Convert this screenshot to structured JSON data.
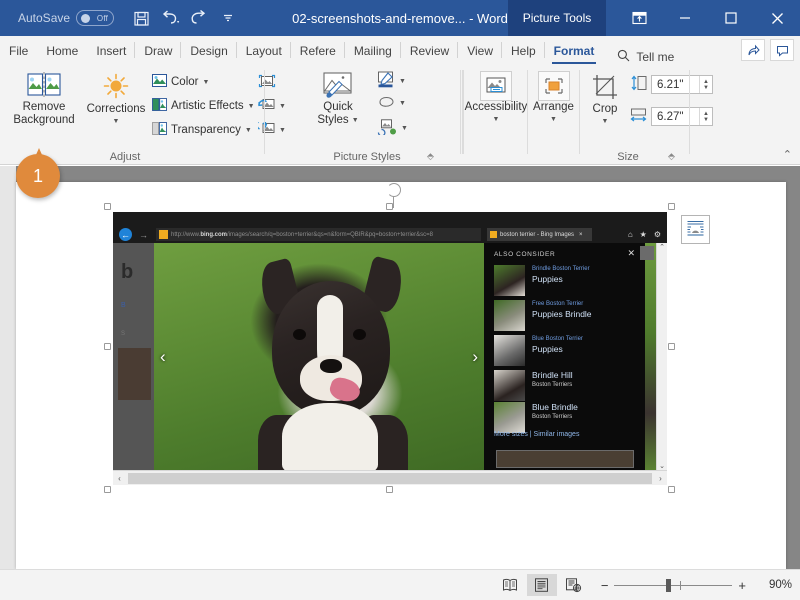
{
  "titlebar": {
    "autosave_label": "AutoSave",
    "autosave_state": "Off",
    "quick_access": [
      {
        "name": "save-icon",
        "label": "Save"
      },
      {
        "name": "undo-icon",
        "label": "Undo"
      },
      {
        "name": "redo-icon",
        "label": "Redo"
      },
      {
        "name": "customize-qat-icon",
        "label": "Customize Quick Access Toolbar"
      }
    ],
    "document_title": "02-screenshots-and-remove... - Word",
    "contextual_tab": "Picture Tools",
    "window_buttons": [
      {
        "name": "ribbon-display-options-icon",
        "label": "Ribbon Display Options"
      },
      {
        "name": "minimize-icon",
        "label": "Minimize"
      },
      {
        "name": "maximize-icon",
        "label": "Maximize"
      },
      {
        "name": "close-icon",
        "label": "Close"
      }
    ],
    "bg_color": "#2b579a",
    "contextual_bg_color": "#1e417d"
  },
  "tabs": [
    {
      "label": "File",
      "active": false
    },
    {
      "label": "Home",
      "active": false
    },
    {
      "label": "Insert",
      "active": false
    },
    {
      "label": "Draw",
      "active": false
    },
    {
      "label": "Design",
      "active": false
    },
    {
      "label": "Layout",
      "active": false
    },
    {
      "label": "Refere",
      "active": false
    },
    {
      "label": "Mailing",
      "active": false
    },
    {
      "label": "Review",
      "active": false
    },
    {
      "label": "View",
      "active": false
    },
    {
      "label": "Help",
      "active": false
    },
    {
      "label": "Format",
      "active": true
    }
  ],
  "tellme": {
    "label": "Tell me",
    "icon": "search-icon"
  },
  "tab_right_buttons": [
    {
      "name": "share-icon",
      "label": "Share"
    },
    {
      "name": "comments-icon",
      "label": "Comments"
    }
  ],
  "ribbon": {
    "collapse_label": "Collapse the Ribbon",
    "groups": [
      {
        "name": "adjust",
        "label": "Adjust",
        "buttons": [
          {
            "name": "remove-background-button",
            "label": "Remove\nBackground",
            "line1": "Remove",
            "line2": "Background",
            "icon": "remove-background-icon"
          },
          {
            "name": "corrections-button",
            "label": "Corrections",
            "icon": "corrections-sun-icon"
          },
          {
            "name": "color-button",
            "label": "Color",
            "icon": "color-picture-icon"
          },
          {
            "name": "artistic-effects-button",
            "label": "Artistic Effects",
            "icon": "artistic-effects-icon"
          },
          {
            "name": "transparency-button",
            "label": "Transparency",
            "icon": "transparency-icon"
          },
          {
            "name": "compress-pictures-button",
            "label": "Compress Pictures",
            "icon": "compress-pictures-icon"
          },
          {
            "name": "change-picture-button",
            "label": "Change Picture",
            "icon": "change-picture-icon"
          },
          {
            "name": "reset-picture-button",
            "label": "Reset Picture",
            "icon": "reset-picture-icon"
          }
        ]
      },
      {
        "name": "picture-styles",
        "label": "Picture Styles",
        "buttons": [
          {
            "name": "quick-styles-button",
            "line1": "Quick",
            "line2": "Styles",
            "label": "Quick Styles",
            "icon": "quick-styles-icon"
          },
          {
            "name": "picture-border-button",
            "label": "Picture Border",
            "icon": "picture-border-pen-icon"
          },
          {
            "name": "picture-effects-button",
            "label": "Picture Effects",
            "icon": "picture-effects-icon"
          },
          {
            "name": "picture-layout-button",
            "label": "Picture Layout",
            "icon": "picture-layout-icon"
          }
        ],
        "dialog_launcher": "Picture Styles dialog box launcher"
      },
      {
        "name": "accessibility",
        "label": "",
        "buttons": [
          {
            "name": "accessibility-button",
            "label": "Accessibility",
            "icon": "accessibility-alt-text-icon"
          }
        ]
      },
      {
        "name": "arrange",
        "label": "",
        "buttons": [
          {
            "name": "arrange-button",
            "label": "Arrange",
            "icon": "arrange-objects-icon"
          }
        ]
      },
      {
        "name": "size",
        "label": "Size",
        "buttons": [
          {
            "name": "crop-button",
            "label": "Crop",
            "icon": "crop-icon"
          }
        ],
        "fields": [
          {
            "name": "shape-height-field",
            "icon": "height-arrow-icon",
            "value": "6.21\"",
            "placeholder": "Height"
          },
          {
            "name": "shape-width-field",
            "icon": "width-arrow-icon",
            "value": "6.27\"",
            "placeholder": "Width"
          }
        ],
        "dialog_launcher": "Size dialog box launcher"
      }
    ]
  },
  "callout": {
    "number": "1",
    "color": "#e08a3c"
  },
  "document": {
    "layout_options_label": "Layout Options",
    "layout_options_icon": "layout-options-icon",
    "selected_image": {
      "name": "selected-picture",
      "rotate_handle": "rotate-handle"
    }
  },
  "screenshot": {
    "browser": {
      "back_icon": "back-arrow-icon",
      "forward_icon": "forward-arrow-icon",
      "url_prefix": "http://www.",
      "url_bold": "bing.com",
      "url_suffix": "/images/search/q=boston+terrier&qs=n&form=QBIR&pq=boston+terrier&sc=8",
      "tab_title": "boston terrier - Bing Images",
      "tab_close": "×",
      "chrome_icons": [
        {
          "name": "home-icon",
          "glyph": "⌂"
        },
        {
          "name": "favorites-star-icon",
          "glyph": "★"
        },
        {
          "name": "settings-gear-icon",
          "glyph": "⚙"
        }
      ]
    },
    "bing_sidebar": {
      "logo": "b",
      "line1": "B",
      "line2": "C",
      "line3": "S"
    },
    "viewer": {
      "prev_arrow": "‹",
      "next_arrow": "›"
    },
    "also_consider": {
      "header": "ALSO CONSIDER",
      "close": "✕",
      "items": [
        {
          "sub": "Brindle Boston Terrier",
          "main": "Puppies"
        },
        {
          "sub": "Free Boston Terrier",
          "main": "Puppies Brindle"
        },
        {
          "sub": "Blue Boston Terrier",
          "main": "Puppies"
        },
        {
          "main": "Brindle Hill",
          "sub2": "Boston Terriers"
        },
        {
          "main": "Blue Brindle",
          "sub2": "Boston Terriers"
        }
      ],
      "footer_links": "More sizes | Similar images"
    },
    "scroll": {
      "up": "⌃",
      "down": "⌄",
      "left": "‹",
      "right": "›"
    }
  },
  "statusbar": {
    "view_buttons": [
      {
        "name": "read-mode-button",
        "label": "Read Mode",
        "selected": false
      },
      {
        "name": "print-layout-button",
        "label": "Print Layout",
        "selected": true
      },
      {
        "name": "web-layout-button",
        "label": "Web Layout",
        "selected": false
      }
    ],
    "zoom_out": "−",
    "zoom_in": "+",
    "zoom_value": "90%"
  }
}
